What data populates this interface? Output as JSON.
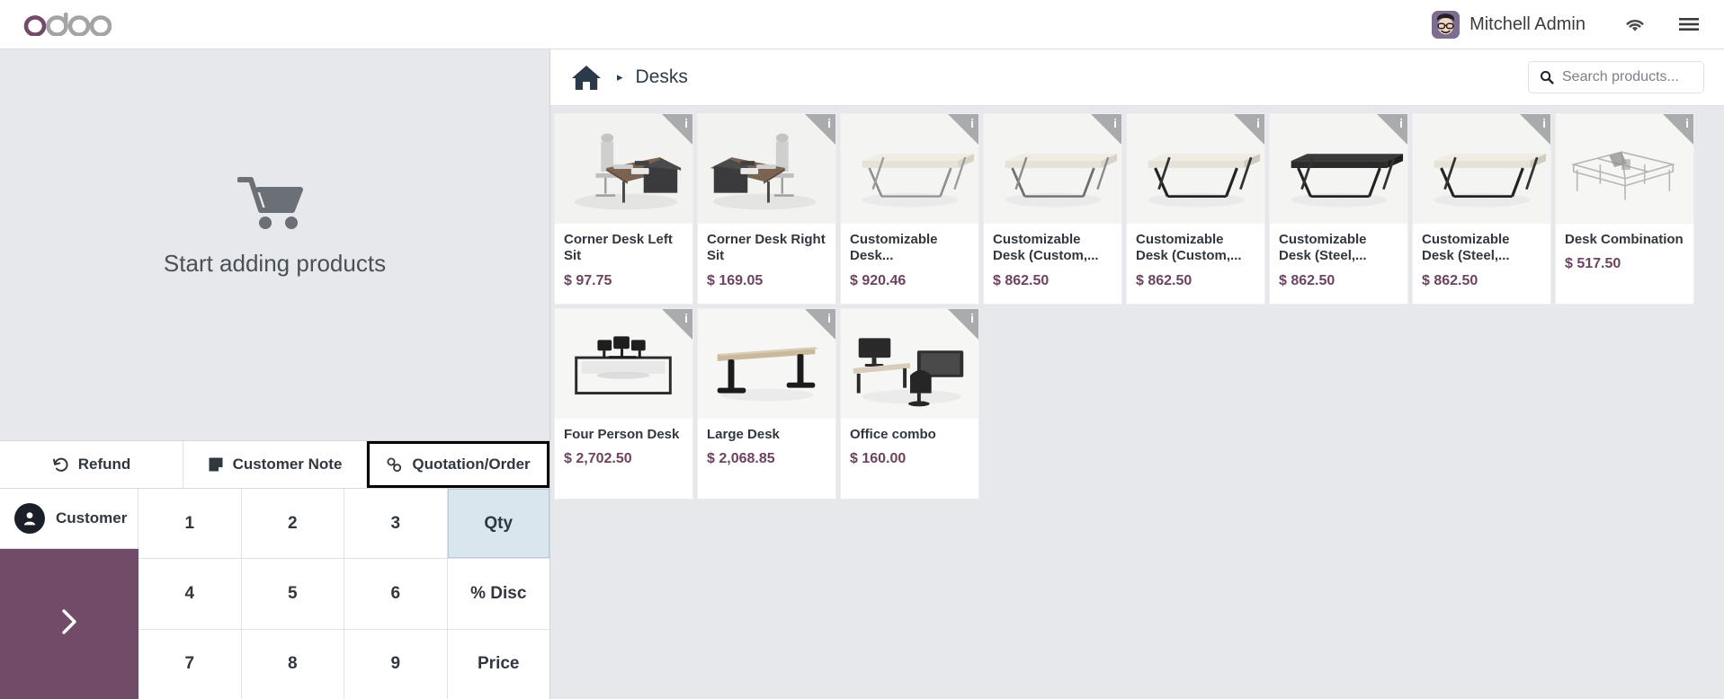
{
  "navbar": {
    "logo_text": "odoo",
    "username": "Mitchell Admin",
    "wifi_icon": "wifi-icon",
    "menu_icon": "hamburger-menu-icon"
  },
  "order_pane": {
    "empty_text": "Start adding products",
    "cart_icon": "shopping-cart-icon",
    "actions": [
      {
        "label": "Refund",
        "icon": "refund-undo-icon",
        "focused": false
      },
      {
        "label": "Customer Note",
        "icon": "note-icon",
        "focused": false
      },
      {
        "label": "Quotation/Order",
        "icon": "chain-link-icon",
        "focused": true
      }
    ],
    "customer_button": {
      "label": "Customer",
      "icon": "person-icon"
    },
    "pay_button": {
      "icon": "chevron-right-icon",
      "color": "#714b67"
    },
    "numpad": [
      {
        "label": "1",
        "type": "digit"
      },
      {
        "label": "2",
        "type": "digit"
      },
      {
        "label": "3",
        "type": "digit"
      },
      {
        "label": "Qty",
        "type": "mode",
        "active": true
      },
      {
        "label": "4",
        "type": "digit"
      },
      {
        "label": "5",
        "type": "digit"
      },
      {
        "label": "6",
        "type": "digit"
      },
      {
        "label": "% Disc",
        "type": "mode",
        "active": false
      },
      {
        "label": "7",
        "type": "digit"
      },
      {
        "label": "8",
        "type": "digit"
      },
      {
        "label": "9",
        "type": "digit"
      },
      {
        "label": "Price",
        "type": "mode",
        "active": false
      }
    ]
  },
  "product_pane": {
    "breadcrumb": {
      "home_icon": "home-icon",
      "separator": "▸",
      "category": "Desks"
    },
    "search": {
      "icon": "search-icon",
      "placeholder": "Search products..."
    },
    "info_badge_label": "i",
    "products": [
      {
        "name": "Corner Desk Left Sit",
        "price": "$ 97.75",
        "image": "corner-desk-left"
      },
      {
        "name": "Corner Desk Right Sit",
        "price": "$ 169.05",
        "image": "corner-desk-right"
      },
      {
        "name": "Customizable Desk...",
        "price": "$ 920.46",
        "image": "plain-desk-light"
      },
      {
        "name": "Customizable Desk (Custom,...",
        "price": "$ 862.50",
        "image": "plain-desk-light"
      },
      {
        "name": "Customizable Desk (Custom,...",
        "price": "$ 862.50",
        "image": "plain-desk-dark"
      },
      {
        "name": "Customizable Desk (Steel,...",
        "price": "$ 862.50",
        "image": "plain-desk-black"
      },
      {
        "name": "Customizable Desk (Steel,...",
        "price": "$ 862.50",
        "image": "plain-desk-light"
      },
      {
        "name": "Desk Combination",
        "price": "$ 517.50",
        "image": "desk-combination"
      },
      {
        "name": "Four Person Desk",
        "price": "$ 2,702.50",
        "image": "four-person-desk"
      },
      {
        "name": "Large Desk",
        "price": "$ 2,068.85",
        "image": "large-desk"
      },
      {
        "name": "Office combo",
        "price": "$ 160.00",
        "image": "office-combo"
      }
    ]
  },
  "colors": {
    "brand_purple": "#714b67",
    "price_text": "#6d4360",
    "dark_text": "#31373f",
    "page_bg": "#e6e8eb"
  }
}
